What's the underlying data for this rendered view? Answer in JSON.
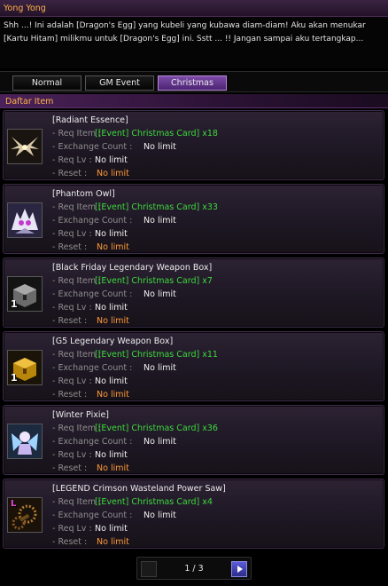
{
  "window": {
    "title": "Yong Yong"
  },
  "dialog": {
    "line1": "Shh ...! Ini adalah [Dragon's Egg] yang kubeli yang kubawa diam-diam! Aku akan menukar",
    "line2": "[Kartu Hitam] milikmu untuk [Dragon's Egg] ini. Sstt ... !! Jangan sampai aku tertangkap..."
  },
  "tabs": [
    {
      "label": "Normal",
      "active": false
    },
    {
      "label": "GM Event",
      "active": false
    },
    {
      "label": "Christmas",
      "active": true
    }
  ],
  "section": {
    "title": "Daftar Item"
  },
  "labels": {
    "req_item": "- Req Item :",
    "exchange_count": "- Exchange Count :",
    "req_lv": "- Req Lv :",
    "reset": "- Reset :"
  },
  "items": [
    {
      "name": "[Radiant Essence]",
      "req_item": "[[Event] Christmas Card] x18",
      "exchange_count": "No limit",
      "req_lv": "No limit",
      "reset": "No limit",
      "icon": "radiant-essence-icon",
      "badge": ""
    },
    {
      "name": "[Phantom Owl]",
      "req_item": "[[Event] Christmas Card] x33",
      "exchange_count": "No limit",
      "req_lv": "No limit",
      "reset": "No limit",
      "icon": "phantom-owl-icon",
      "badge": ""
    },
    {
      "name": "[Black Friday Legendary Weapon Box]",
      "req_item": "[[Event] Christmas Card] x7",
      "exchange_count": "No limit",
      "req_lv": "No limit",
      "reset": "No limit",
      "icon": "weapon-box-icon",
      "badge": "1"
    },
    {
      "name": "[G5 Legendary Weapon Box]",
      "req_item": "[[Event] Christmas Card] x11",
      "exchange_count": "No limit",
      "req_lv": "No limit",
      "reset": "No limit",
      "icon": "gold-box-icon",
      "badge": "1"
    },
    {
      "name": "[Winter Pixie]",
      "req_item": "[[Event] Christmas Card] x36",
      "exchange_count": "No limit",
      "req_lv": "No limit",
      "reset": "No limit",
      "icon": "winter-pixie-icon",
      "badge": ""
    },
    {
      "name": "[LEGEND Crimson Wasteland Power Saw]",
      "req_item": "[[Event] Christmas Card] x4",
      "exchange_count": "No limit",
      "req_lv": "No limit",
      "reset": "No limit",
      "icon": "power-saw-icon",
      "badge": "L"
    }
  ],
  "pager": {
    "text": "1 / 3"
  }
}
